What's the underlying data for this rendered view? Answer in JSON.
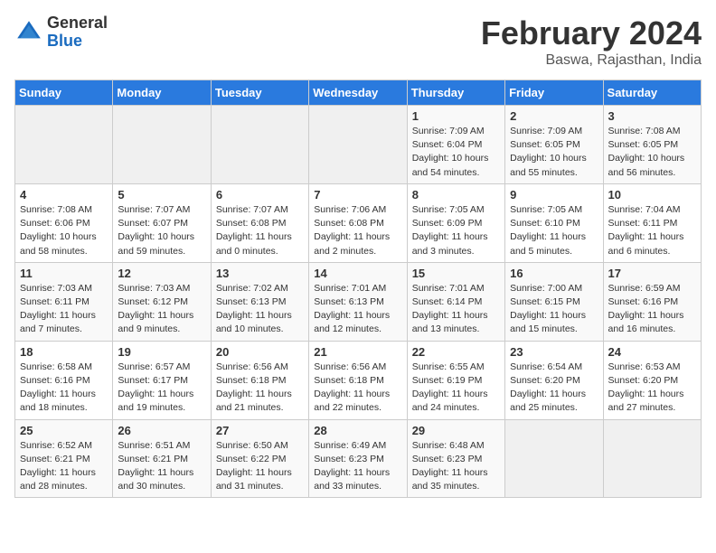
{
  "logo": {
    "general": "General",
    "blue": "Blue"
  },
  "title": "February 2024",
  "subtitle": "Baswa, Rajasthan, India",
  "days_of_week": [
    "Sunday",
    "Monday",
    "Tuesday",
    "Wednesday",
    "Thursday",
    "Friday",
    "Saturday"
  ],
  "weeks": [
    [
      {
        "num": "",
        "info": "",
        "empty": true
      },
      {
        "num": "",
        "info": "",
        "empty": true
      },
      {
        "num": "",
        "info": "",
        "empty": true
      },
      {
        "num": "",
        "info": "",
        "empty": true
      },
      {
        "num": "1",
        "info": "Sunrise: 7:09 AM\nSunset: 6:04 PM\nDaylight: 10 hours\nand 54 minutes."
      },
      {
        "num": "2",
        "info": "Sunrise: 7:09 AM\nSunset: 6:05 PM\nDaylight: 10 hours\nand 55 minutes."
      },
      {
        "num": "3",
        "info": "Sunrise: 7:08 AM\nSunset: 6:05 PM\nDaylight: 10 hours\nand 56 minutes."
      }
    ],
    [
      {
        "num": "4",
        "info": "Sunrise: 7:08 AM\nSunset: 6:06 PM\nDaylight: 10 hours\nand 58 minutes."
      },
      {
        "num": "5",
        "info": "Sunrise: 7:07 AM\nSunset: 6:07 PM\nDaylight: 10 hours\nand 59 minutes."
      },
      {
        "num": "6",
        "info": "Sunrise: 7:07 AM\nSunset: 6:08 PM\nDaylight: 11 hours\nand 0 minutes."
      },
      {
        "num": "7",
        "info": "Sunrise: 7:06 AM\nSunset: 6:08 PM\nDaylight: 11 hours\nand 2 minutes."
      },
      {
        "num": "8",
        "info": "Sunrise: 7:05 AM\nSunset: 6:09 PM\nDaylight: 11 hours\nand 3 minutes."
      },
      {
        "num": "9",
        "info": "Sunrise: 7:05 AM\nSunset: 6:10 PM\nDaylight: 11 hours\nand 5 minutes."
      },
      {
        "num": "10",
        "info": "Sunrise: 7:04 AM\nSunset: 6:11 PM\nDaylight: 11 hours\nand 6 minutes."
      }
    ],
    [
      {
        "num": "11",
        "info": "Sunrise: 7:03 AM\nSunset: 6:11 PM\nDaylight: 11 hours\nand 7 minutes."
      },
      {
        "num": "12",
        "info": "Sunrise: 7:03 AM\nSunset: 6:12 PM\nDaylight: 11 hours\nand 9 minutes."
      },
      {
        "num": "13",
        "info": "Sunrise: 7:02 AM\nSunset: 6:13 PM\nDaylight: 11 hours\nand 10 minutes."
      },
      {
        "num": "14",
        "info": "Sunrise: 7:01 AM\nSunset: 6:13 PM\nDaylight: 11 hours\nand 12 minutes."
      },
      {
        "num": "15",
        "info": "Sunrise: 7:01 AM\nSunset: 6:14 PM\nDaylight: 11 hours\nand 13 minutes."
      },
      {
        "num": "16",
        "info": "Sunrise: 7:00 AM\nSunset: 6:15 PM\nDaylight: 11 hours\nand 15 minutes."
      },
      {
        "num": "17",
        "info": "Sunrise: 6:59 AM\nSunset: 6:16 PM\nDaylight: 11 hours\nand 16 minutes."
      }
    ],
    [
      {
        "num": "18",
        "info": "Sunrise: 6:58 AM\nSunset: 6:16 PM\nDaylight: 11 hours\nand 18 minutes."
      },
      {
        "num": "19",
        "info": "Sunrise: 6:57 AM\nSunset: 6:17 PM\nDaylight: 11 hours\nand 19 minutes."
      },
      {
        "num": "20",
        "info": "Sunrise: 6:56 AM\nSunset: 6:18 PM\nDaylight: 11 hours\nand 21 minutes."
      },
      {
        "num": "21",
        "info": "Sunrise: 6:56 AM\nSunset: 6:18 PM\nDaylight: 11 hours\nand 22 minutes."
      },
      {
        "num": "22",
        "info": "Sunrise: 6:55 AM\nSunset: 6:19 PM\nDaylight: 11 hours\nand 24 minutes."
      },
      {
        "num": "23",
        "info": "Sunrise: 6:54 AM\nSunset: 6:20 PM\nDaylight: 11 hours\nand 25 minutes."
      },
      {
        "num": "24",
        "info": "Sunrise: 6:53 AM\nSunset: 6:20 PM\nDaylight: 11 hours\nand 27 minutes."
      }
    ],
    [
      {
        "num": "25",
        "info": "Sunrise: 6:52 AM\nSunset: 6:21 PM\nDaylight: 11 hours\nand 28 minutes."
      },
      {
        "num": "26",
        "info": "Sunrise: 6:51 AM\nSunset: 6:21 PM\nDaylight: 11 hours\nand 30 minutes."
      },
      {
        "num": "27",
        "info": "Sunrise: 6:50 AM\nSunset: 6:22 PM\nDaylight: 11 hours\nand 31 minutes."
      },
      {
        "num": "28",
        "info": "Sunrise: 6:49 AM\nSunset: 6:23 PM\nDaylight: 11 hours\nand 33 minutes."
      },
      {
        "num": "29",
        "info": "Sunrise: 6:48 AM\nSunset: 6:23 PM\nDaylight: 11 hours\nand 35 minutes."
      },
      {
        "num": "",
        "info": "",
        "empty": true
      },
      {
        "num": "",
        "info": "",
        "empty": true
      }
    ]
  ]
}
